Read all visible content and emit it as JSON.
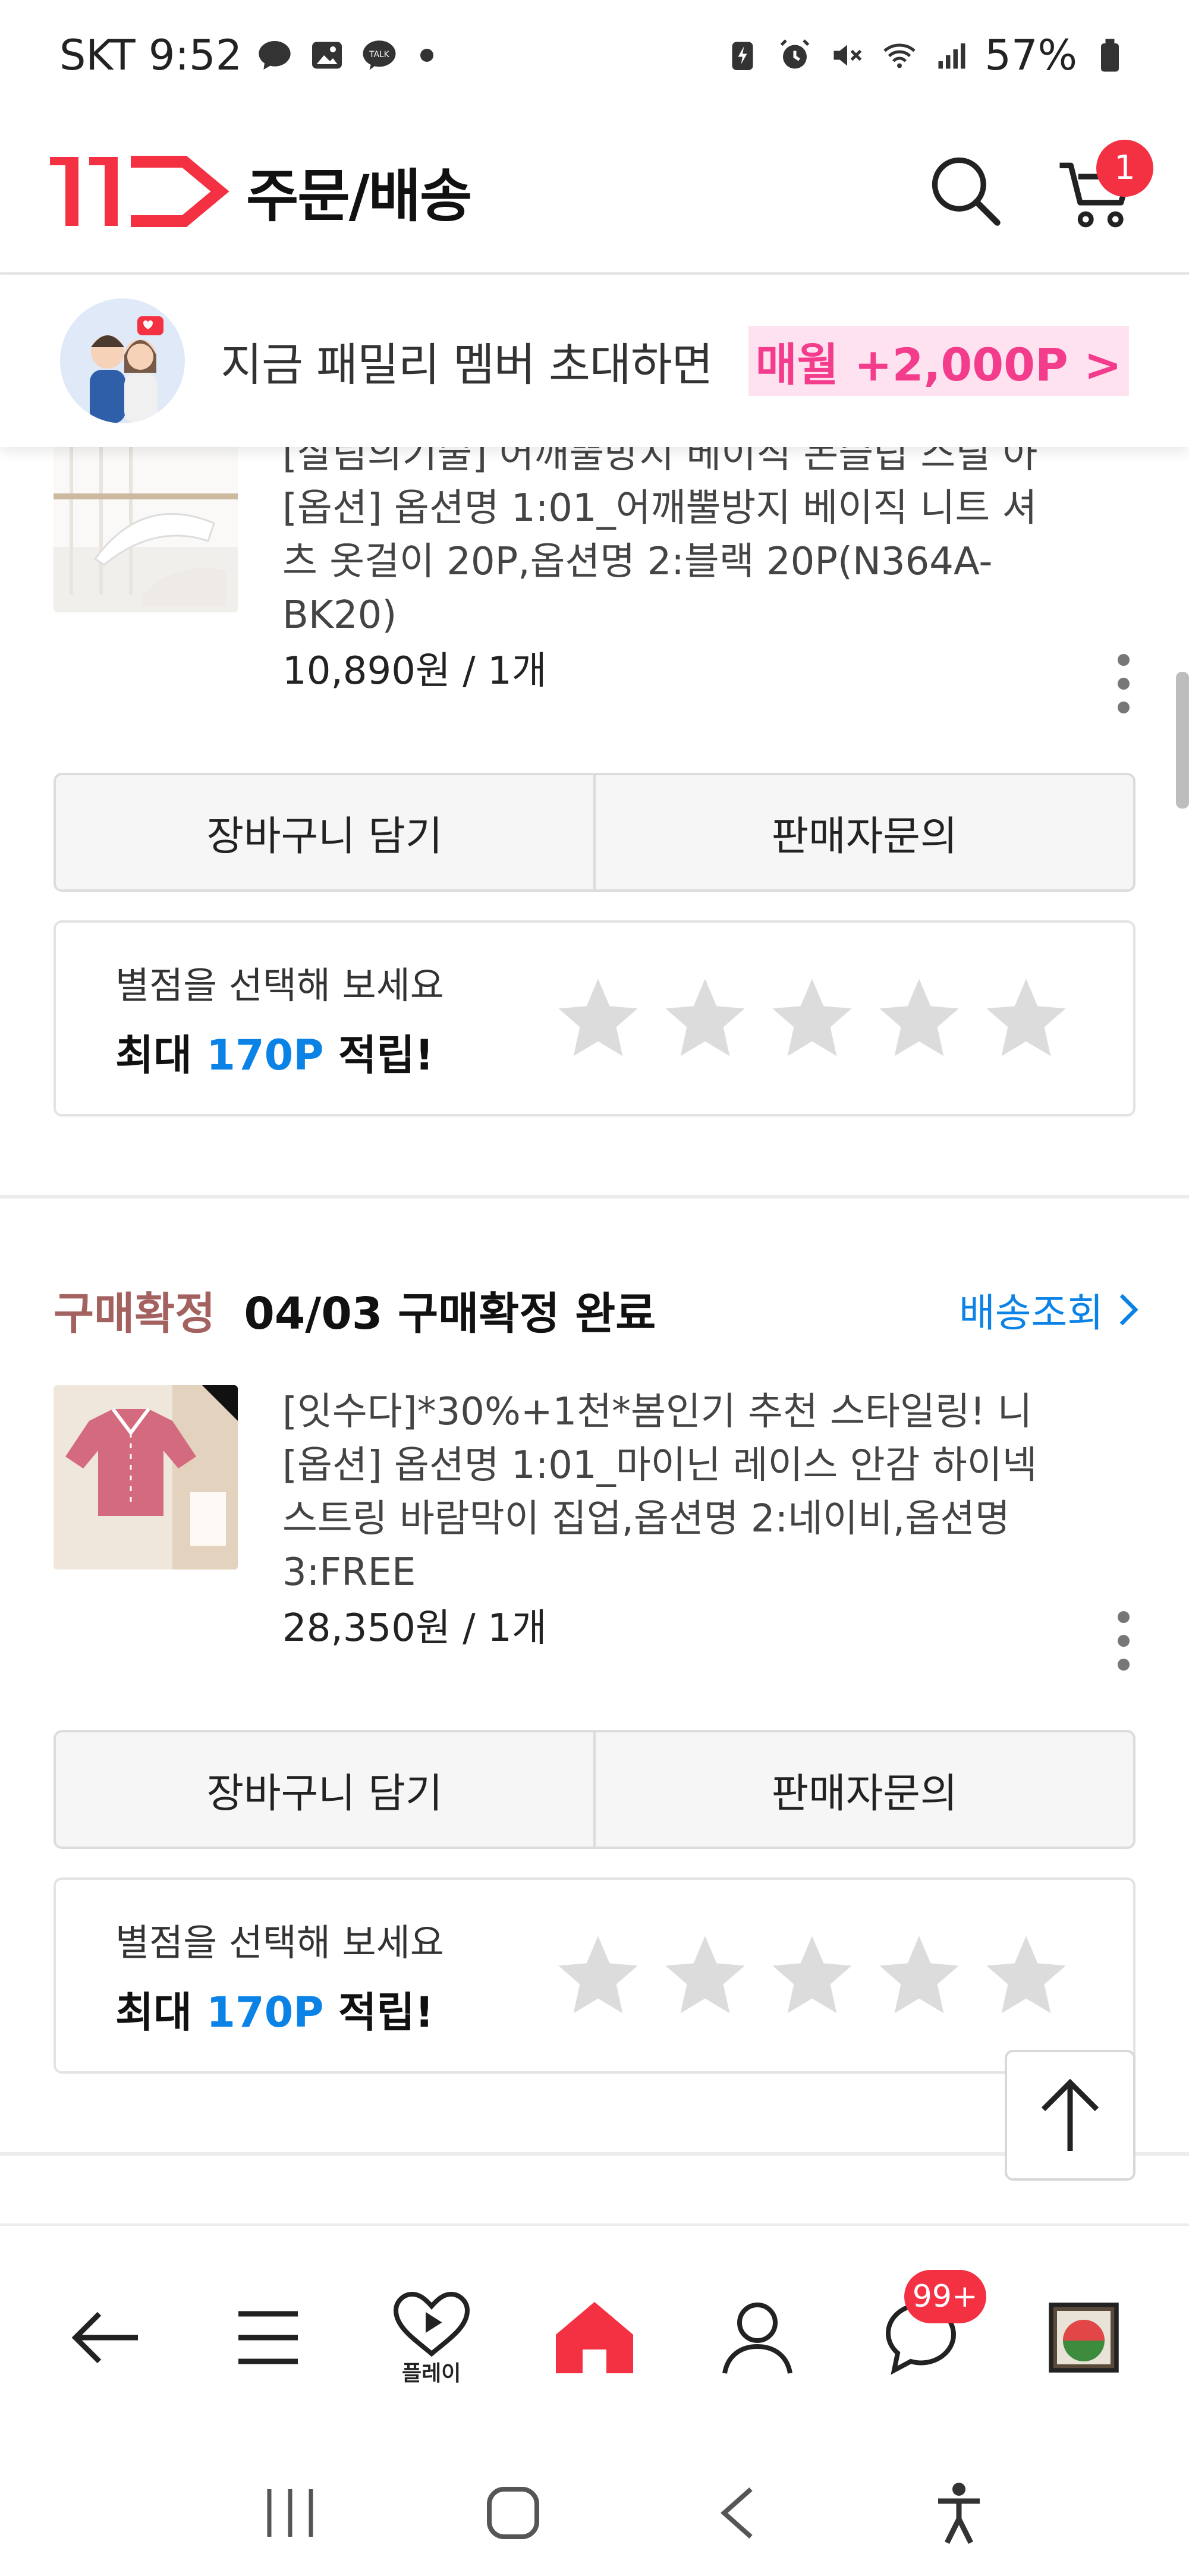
{
  "status_bar": {
    "carrier_time": "SKT 9:52",
    "battery": "57%",
    "icons_left": [
      "chat-bubble-icon",
      "gallery-icon",
      "talk-icon"
    ],
    "icons_right": [
      "battery-saver-icon",
      "alarm-icon",
      "mute-icon",
      "wifi-icon",
      "signal-icon",
      "battery-icon"
    ]
  },
  "header": {
    "logo_text": "11",
    "title": "주문/배송",
    "cart_count": "1"
  },
  "promo": {
    "text": "지금 패밀리 멤버 초대하면",
    "highlight": "매월 +2,000P >"
  },
  "orders": [
    {
      "status_label": "",
      "status_desc": "",
      "name": "[살림의기술] 어깨뿔방지 베이직 논슬립 스틸 아",
      "option": "[옵션] 옵션명 1:01_어깨뿔방지 베이직 니트 셔츠 옷걸이 20P,옵션명 2:블랙 20P(N364A-BK20)",
      "option_lines": [
        "[옵션] 옵션명 1:01_어깨뿔방지 베이직 니트 셔",
        "츠 옷걸이 20P,옵션명 2:블랙 20P(N364A-",
        "BK20)"
      ],
      "price": "10,890원 / 1개"
    },
    {
      "status_label": "구매확정",
      "status_desc": "04/03 구매확정 완료",
      "track_link": "배송조회",
      "name": "[잇수다]*30%+1천*봄인기 추천 스타일링! 니",
      "option_lines": [
        "[옵션] 옵션명 1:01_마이닌 레이스 안감 하이넥",
        "스트링 바람막이 집업,옵션명 2:네이비,옵션명",
        "3:FREE"
      ],
      "price": "28,350원 / 1개"
    }
  ],
  "buttons": {
    "cart": "장바구니 담기",
    "inquiry": "판매자문의"
  },
  "rating": {
    "prompt": "별점을 선택해 보세요",
    "reward_prefix": "최대",
    "reward_points": "170P",
    "reward_suffix": "적립!",
    "stars_selected": 0,
    "stars_total": 5
  },
  "bottom_nav": {
    "play_label": "플레이",
    "talk_badge": "99+"
  },
  "colors": {
    "brand_red": "#f43142",
    "link_blue": "#0b83e6",
    "promo_pink": "#f43c8c",
    "status_brown": "#a3625f"
  }
}
